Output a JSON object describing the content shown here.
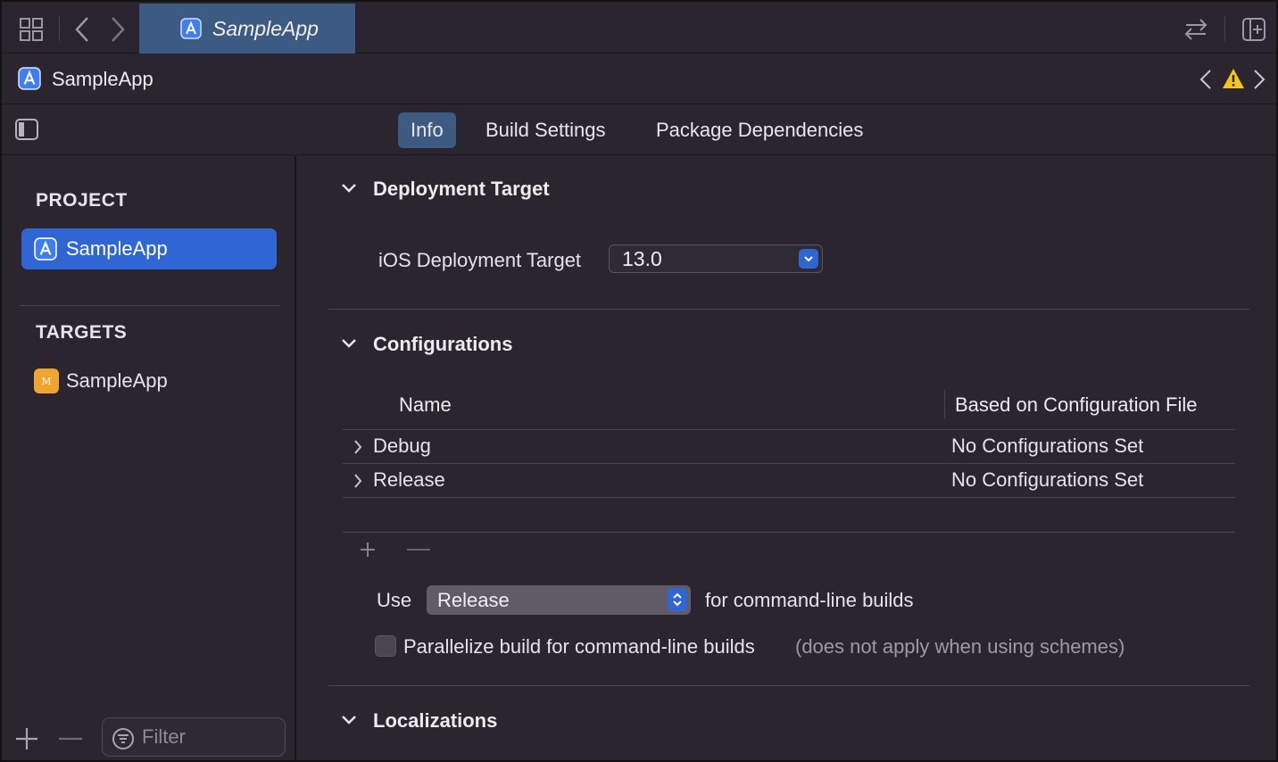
{
  "tabbar": {
    "tab_label": "SampleApp"
  },
  "jumpbar": {
    "title": "SampleApp"
  },
  "editor_tabs": [
    {
      "label": "Info",
      "active": true
    },
    {
      "label": "Build Settings",
      "active": false
    },
    {
      "label": "Package Dependencies",
      "active": false
    }
  ],
  "sidebar": {
    "project_header": "PROJECT",
    "project_item": "SampleApp",
    "targets_header": "TARGETS",
    "target_item": "SampleApp",
    "target_icon_letter": "M",
    "filter_placeholder": "Filter"
  },
  "deployment": {
    "title": "Deployment Target",
    "label": "iOS Deployment Target",
    "value": "13.0"
  },
  "configurations": {
    "title": "Configurations",
    "col_name": "Name",
    "col_file": "Based on Configuration File",
    "rows": [
      {
        "name": "Debug",
        "file": "No Configurations Set"
      },
      {
        "name": "Release",
        "file": "No Configurations Set"
      }
    ],
    "use_label": "Use",
    "use_value": "Release",
    "use_suffix": "for command-line builds",
    "parallelize_label": "Parallelize build for command-line builds",
    "parallelize_note": "(does not apply when using schemes)",
    "parallelize_checked": false
  },
  "localizations": {
    "title": "Localizations"
  },
  "colors": {
    "accent": "#2f66d3",
    "selected_tab": "#3d5b80",
    "warning": "#f5c518",
    "target_icon": "#f0a530"
  }
}
